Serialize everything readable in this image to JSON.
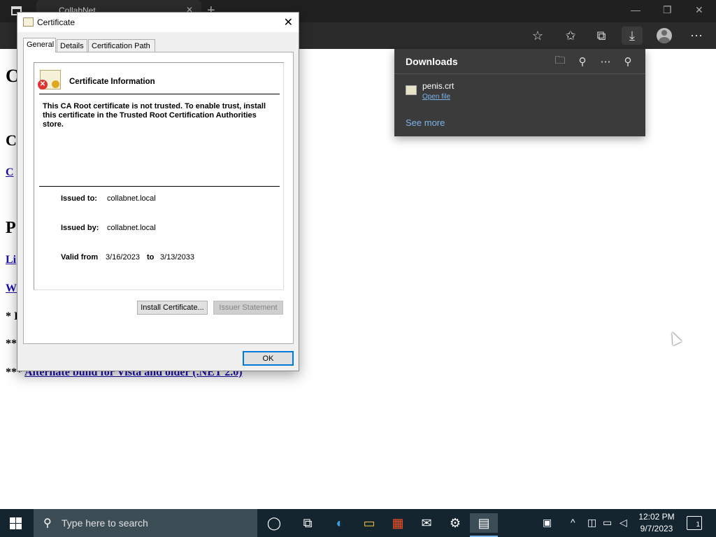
{
  "browser": {
    "tab_title": "CollabNet",
    "tab_close": "✕",
    "new_tab": "+",
    "win_min": "—",
    "win_restore": "❐",
    "win_close": "✕",
    "menu": "⋯"
  },
  "page": {
    "heading1": "C",
    "heading2": "C",
    "link1": "C",
    "heading3": "P",
    "link2": "Li",
    "link3": "W",
    "text1": "* I",
    "text2": "**",
    "text3_prefix": "***",
    "link4": "Alternate build for Vista and older (.NET 2.0)"
  },
  "downloads": {
    "title": "Downloads",
    "file_name": "penis.crt",
    "open_file": "Open file",
    "see_more": "See more"
  },
  "certificate": {
    "window_title": "Certificate",
    "tabs": [
      "General",
      "Details",
      "Certification Path"
    ],
    "info_title": "Certificate Information",
    "warning": "This CA Root certificate is not trusted. To enable trust, install this certificate in the Trusted Root Certification Authorities store.",
    "issued_to_label": "Issued to:",
    "issued_to": "collabnet.local",
    "issued_by_label": "Issued by:",
    "issued_by": "collabnet.local",
    "valid_from_label": "Valid from",
    "valid_from": "3/16/2023",
    "to_label": "to",
    "valid_to": "3/13/2033",
    "install_button": "Install Certificate...",
    "issuer_statement_button": "Issuer Statement",
    "ok_button": "OK",
    "close": "✕"
  },
  "taskbar": {
    "search_placeholder": "Type here to search",
    "time": "12:02 PM",
    "date": "9/7/2023",
    "notification_count": "1"
  }
}
